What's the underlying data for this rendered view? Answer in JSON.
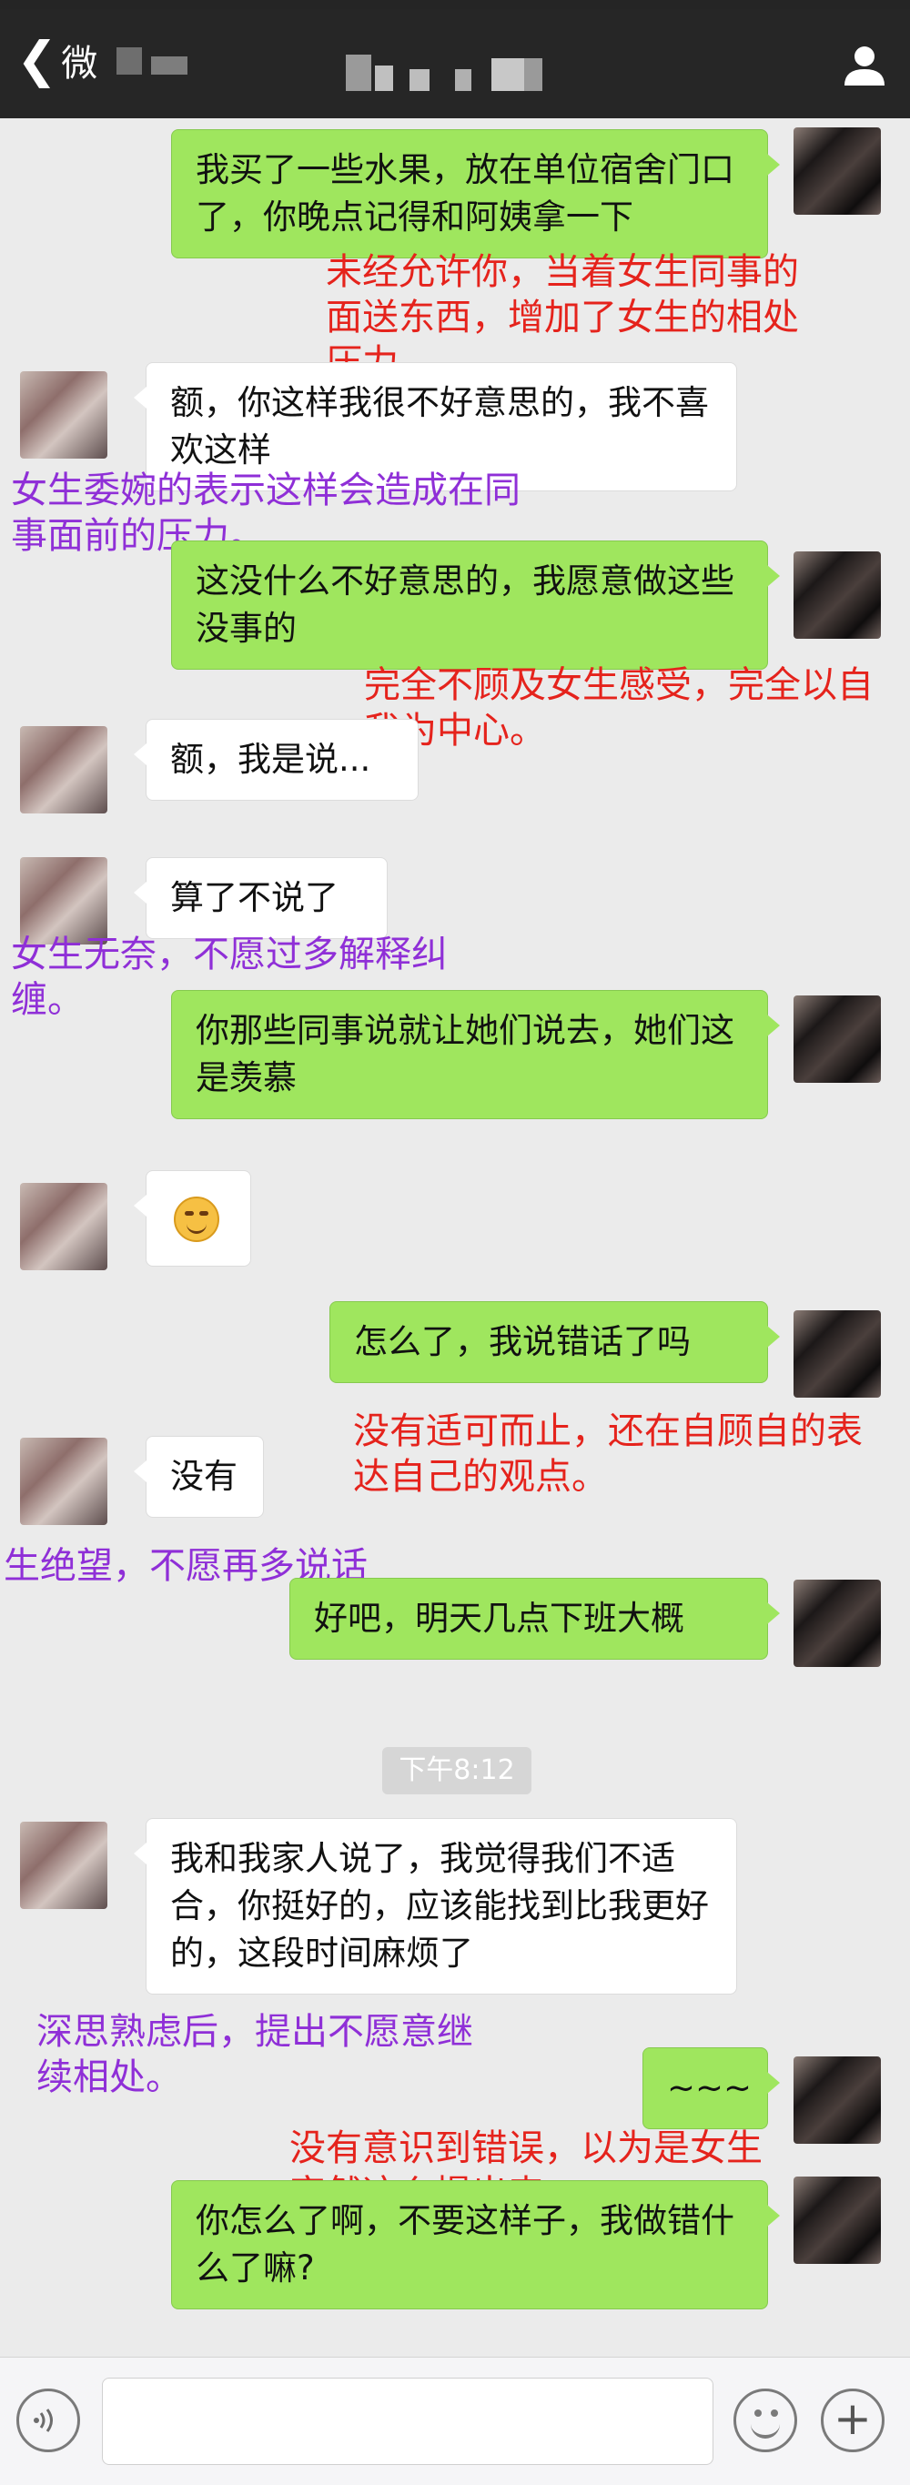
{
  "header": {
    "back_label": "微",
    "back_chevron": "❮"
  },
  "messages": [
    {
      "from": "me",
      "text": "我买了一些水果，放在单位宿舍门口了，你晚点记得和阿姨拿一下"
    },
    {
      "from": "her",
      "text": "额，你这样我很不好意思的，我不喜欢这样"
    },
    {
      "from": "me",
      "text": "这没什么不好意思的，我愿意做这些没事的"
    },
    {
      "from": "her",
      "text": "额，我是说..."
    },
    {
      "from": "her",
      "text": "算了不说了"
    },
    {
      "from": "me",
      "text": "你那些同事说就让她们说去，她们这是羡慕"
    },
    {
      "from": "her",
      "text": "",
      "emoji": "grimace-emoji"
    },
    {
      "from": "me",
      "text": "怎么了，我说错话了吗"
    },
    {
      "from": "her",
      "text": "没有"
    },
    {
      "from": "me",
      "text": "好吧，明天几点下班大概"
    },
    {
      "from": "her",
      "text": "我和我家人说了，我觉得我们不适合，你挺好的，应该能找到比我更好的，这段时间麻烦了"
    },
    {
      "from": "me",
      "text": "~~~"
    },
    {
      "from": "me",
      "text": "你怎么了啊，不要这样子，我做错什么了嘛?"
    }
  ],
  "timestamp": "下午8:12",
  "annotations": [
    {
      "color": "red",
      "text": "未经允许你，当着女生同事的面送东西，增加了女生的相处压力。"
    },
    {
      "color": "purple",
      "text": "女生委婉的表示这样会造成在同事面前的压力。"
    },
    {
      "color": "red",
      "text": "完全不顾及女生感受，完全以自我为中心。"
    },
    {
      "color": "purple",
      "text": "女生无奈，不愿过多解释纠缠。"
    },
    {
      "color": "red",
      "text": "没有适可而止，还在自顾自的表达自己的观点。"
    },
    {
      "color": "purple",
      "text": "生绝望，不愿再多说话"
    },
    {
      "color": "purple",
      "text": "深思熟虑后，提出不愿意继续相处。"
    },
    {
      "color": "red",
      "text": "没有意识到错误，以为是女生突然这么提出来。"
    }
  ],
  "input": {
    "value": "",
    "placeholder": "",
    "plus_label": "+"
  },
  "colors": {
    "header_bg": "#262626",
    "chat_bg": "#ebebeb",
    "outgoing_bubble": "#9fe65e",
    "incoming_bubble": "#ffffff",
    "annotation_red": "#e5231c",
    "annotation_purple": "#8f2fd7"
  },
  "icons": [
    "back-chevron-icon",
    "profile-icon",
    "voice-icon",
    "emoji-icon",
    "plus-icon"
  ]
}
